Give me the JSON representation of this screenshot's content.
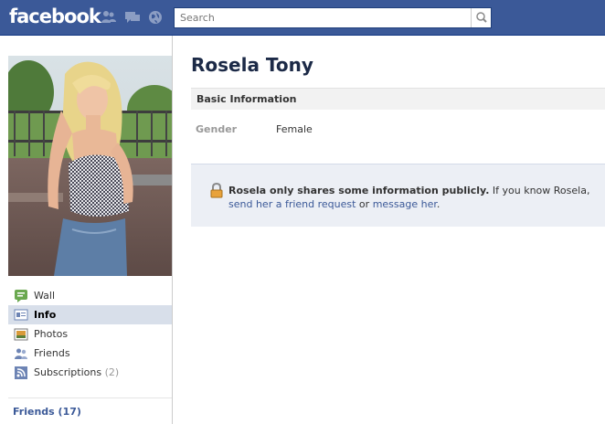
{
  "header": {
    "logo": "facebook",
    "search_placeholder": "Search",
    "icons": [
      "friend-requests-icon",
      "messages-icon",
      "notifications-icon",
      "search-icon"
    ]
  },
  "profile": {
    "name": "Rosela Tony",
    "photo_alt": "profile picture"
  },
  "nav": {
    "items": [
      {
        "label": "Wall",
        "icon": "wall-icon"
      },
      {
        "label": "Info",
        "icon": "info-icon",
        "active": true
      },
      {
        "label": "Photos",
        "icon": "photos-icon"
      },
      {
        "label": "Friends",
        "icon": "friends-icon"
      },
      {
        "label": "Subscriptions",
        "icon": "subscriptions-icon",
        "count": "(2)"
      }
    ],
    "friends_heading": "Friends (17)"
  },
  "basic_info": {
    "heading": "Basic Information",
    "gender_label": "Gender",
    "gender_value": "Female"
  },
  "notice": {
    "bold": "Rosela only shares some information publicly.",
    "text1": " If you know Rosela,",
    "link1": "send her a friend request",
    "text2": " or ",
    "link2": "message her",
    "text3": "."
  },
  "colors": {
    "brand": "#3b5998",
    "nav_active": "#d8dfea",
    "notice_bg": "#eceff5"
  }
}
